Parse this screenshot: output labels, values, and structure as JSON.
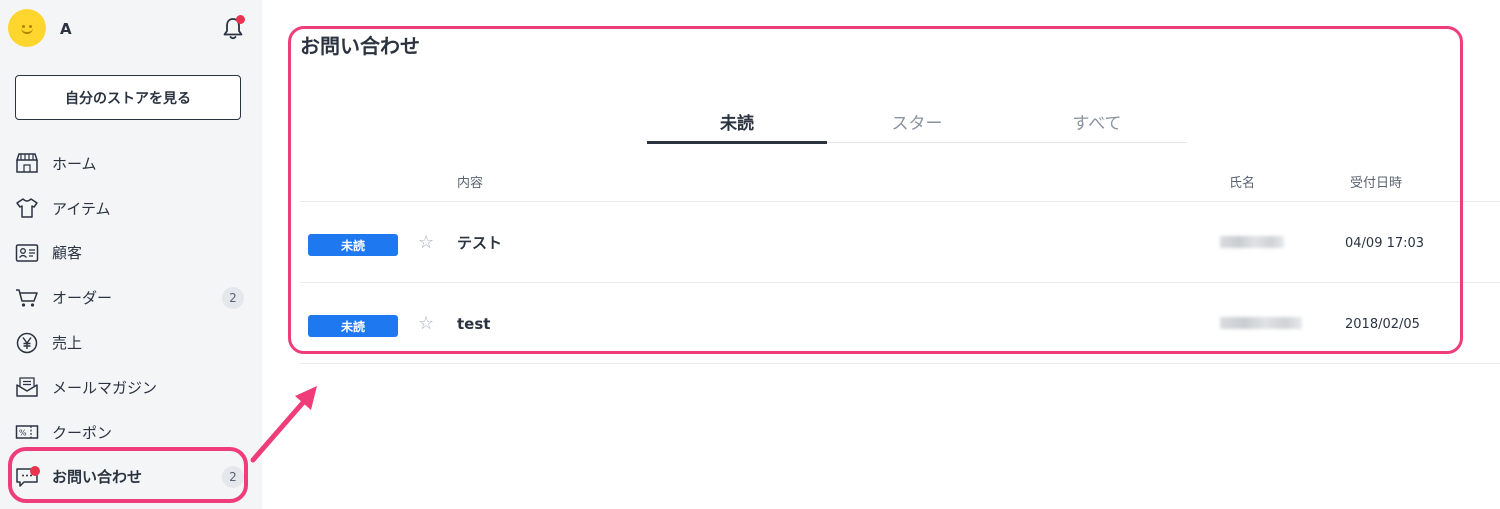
{
  "sidebar": {
    "user_name": "A",
    "store_button": "自分のストアを見る",
    "items": [
      {
        "label": "ホーム",
        "icon": "store-icon",
        "badge": ""
      },
      {
        "label": "アイテム",
        "icon": "shirt-icon",
        "badge": ""
      },
      {
        "label": "顧客",
        "icon": "id-card-icon",
        "badge": ""
      },
      {
        "label": "オーダー",
        "icon": "cart-icon",
        "badge": "2"
      },
      {
        "label": "売上",
        "icon": "yen-icon",
        "badge": ""
      },
      {
        "label": "メールマガジン",
        "icon": "mail-icon",
        "badge": ""
      },
      {
        "label": "クーポン",
        "icon": "coupon-icon",
        "badge": ""
      },
      {
        "label": "お問い合わせ",
        "icon": "chat-icon",
        "badge": "2",
        "active": true
      }
    ]
  },
  "main": {
    "title": "お問い合わせ",
    "tabs": [
      {
        "label": "未読",
        "active": true
      },
      {
        "label": "スター",
        "active": false
      },
      {
        "label": "すべて",
        "active": false
      }
    ],
    "columns": {
      "content": "内容",
      "name": "氏名",
      "received": "受付日時"
    },
    "rows": [
      {
        "status": "未読",
        "subject": "テスト",
        "date": "04/09 17:03"
      },
      {
        "status": "未読",
        "subject": "test",
        "date": "2018/02/05"
      }
    ]
  },
  "colors": {
    "highlight": "#ef3d79",
    "unread_badge": "#1e78f0",
    "notification_dot": "#e8344e",
    "avatar": "#ffd62e"
  }
}
